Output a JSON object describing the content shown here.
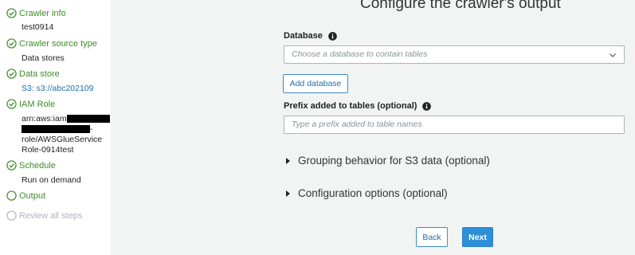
{
  "sidebar": {
    "steps": [
      {
        "title": "Crawler info",
        "value": "test0914",
        "state": "complete"
      },
      {
        "title": "Crawler source type",
        "value": "Data stores",
        "state": "complete"
      },
      {
        "title": "Data store",
        "value": "S3: s3://abc202109",
        "state": "complete"
      },
      {
        "title": "IAM Role",
        "lines": [
          "arn:aws:iam",
          "-",
          "role/AWSGlueService",
          "Role-0914test"
        ],
        "state": "complete"
      },
      {
        "title": "Schedule",
        "value": "Run on demand",
        "state": "complete"
      },
      {
        "title": "Output",
        "state": "current"
      },
      {
        "title": "Review all steps",
        "state": "disabled"
      }
    ]
  },
  "main": {
    "title": "Configure the crawler's output",
    "database": {
      "label": "Database",
      "placeholder": "Choose a database to contain tables"
    },
    "add_database_label": "Add database",
    "prefix": {
      "label": "Prefix added to tables (optional)",
      "placeholder": "Type a prefix added to table names"
    },
    "sections": [
      "Grouping behavior for S3 data (optional)",
      "Configuration options (optional)"
    ],
    "back_label": "Back",
    "next_label": "Next"
  },
  "colors": {
    "complete": "#3d8c28",
    "disabled": "#a9b7c2",
    "primary": "#2d8fd8",
    "link": "#1f6ea8"
  },
  "icons": {
    "complete": "check-circle-icon",
    "current": "empty-circle-icon",
    "info": "info-icon",
    "dropdown": "chevron-down-icon",
    "expand": "caret-right-icon"
  }
}
